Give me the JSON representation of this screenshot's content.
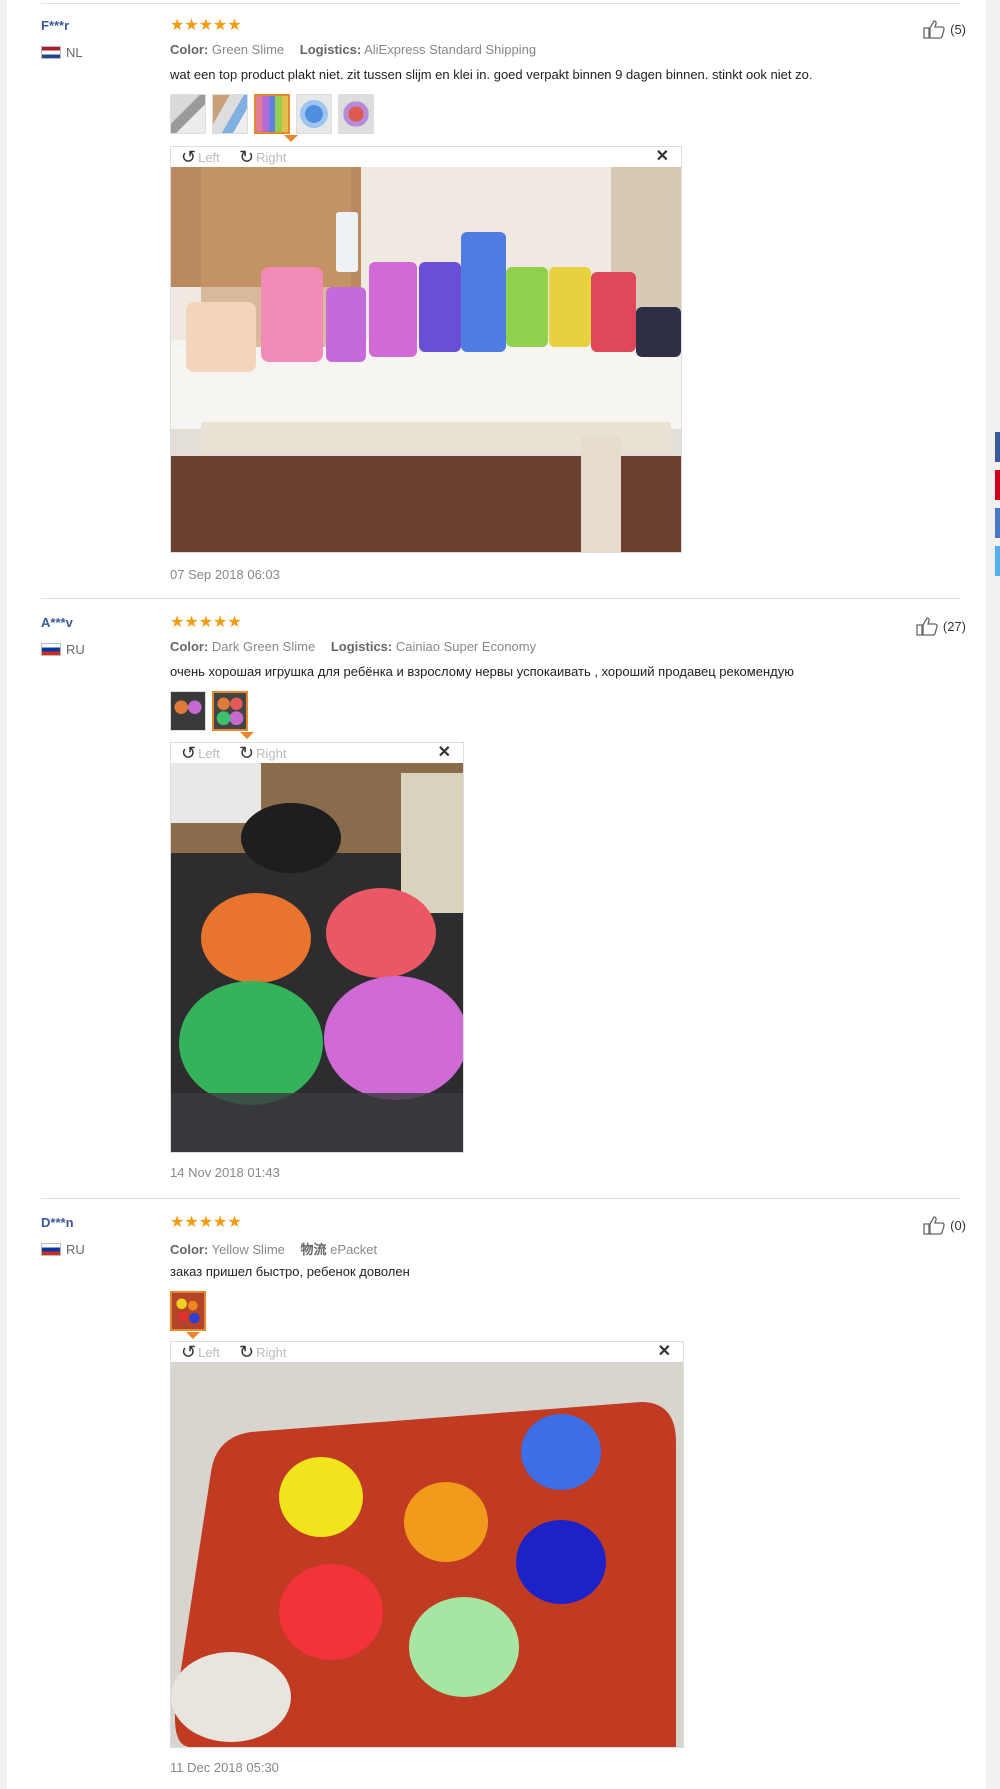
{
  "reviews": [
    {
      "user": "F***r",
      "country": "NL",
      "rating": "★★★★★",
      "color_label": "Color:",
      "color": "Green Slime",
      "logistics_label": "Logistics:",
      "logistics": "AliExpress Standard Shipping",
      "text": "wat een top product plakt niet. zit tussen slijm en klei in. goed verpakt binnen 9 dagen binnen. stinkt ook niet zo.",
      "left_label": "Left",
      "right_label": "Right",
      "date": "07 Sep 2018 06:03",
      "likes": "(5)"
    },
    {
      "user": "A***v",
      "country": "RU",
      "rating": "★★★★★",
      "color_label": "Color:",
      "color": "Dark Green Slime",
      "logistics_label": "Logistics:",
      "logistics": "Cainiao Super Economy",
      "text": "очень хорошая игрушка для ребёнка и взрослому нервы успокаивать , хороший продавец рекомендую",
      "left_label": "Left",
      "right_label": "Right",
      "date": "14 Nov 2018 01:43",
      "likes": "(27)"
    },
    {
      "user": "D***n",
      "country": "RU",
      "rating": "★★★★★",
      "color_label": "Color:",
      "color": "Yellow Slime",
      "logistics_label": "物流",
      "logistics": "ePacket",
      "text": "заказ пришел быстро, ребенок доволен",
      "left_label": "Left",
      "right_label": "Right",
      "date": "11 Dec 2018 05:30",
      "likes": "(0)"
    }
  ],
  "icons": {
    "like": "thumbs-up-icon",
    "rotate_left": "rotate-left-icon",
    "rotate_right": "rotate-right-icon",
    "close": "close-icon"
  },
  "colors": {
    "accent": "#e6872b",
    "star": "#f39c12",
    "username": "#3b5998"
  }
}
